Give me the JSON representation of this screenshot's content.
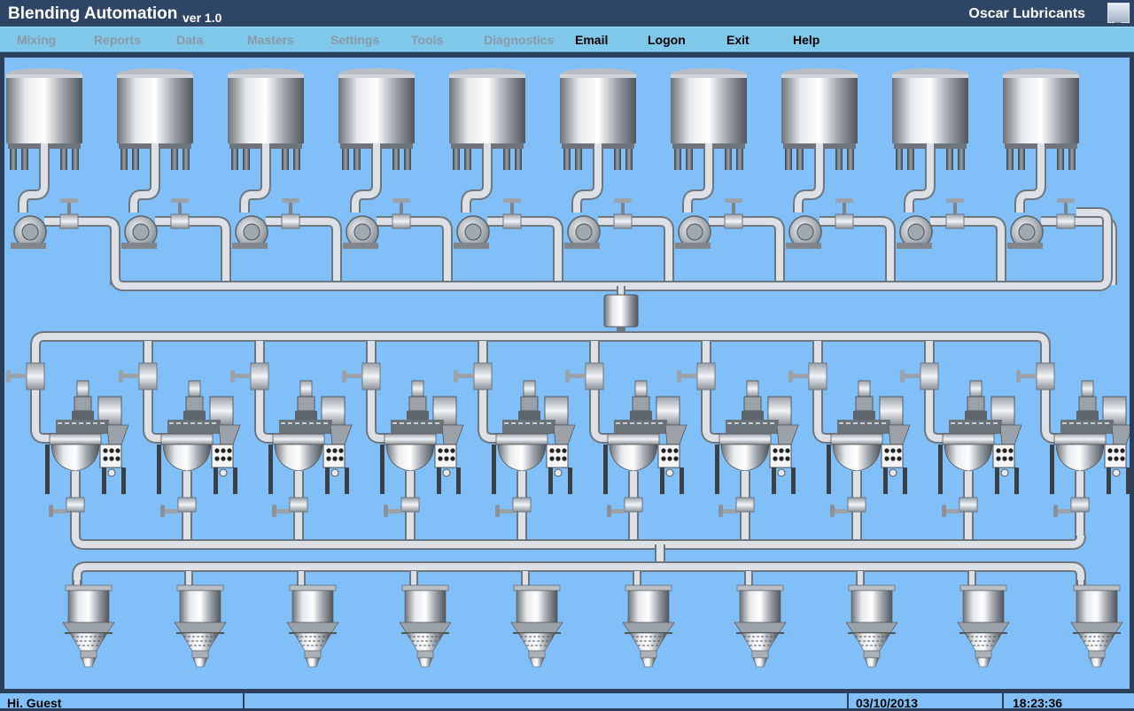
{
  "app": {
    "title": "Blending Automation",
    "version": "ver 1.0",
    "company": "Oscar Lubricants",
    "minimize_glyph": "_"
  },
  "menu": [
    {
      "label": "Mixing",
      "enabled": false
    },
    {
      "label": "Reports",
      "enabled": false
    },
    {
      "label": "Data",
      "enabled": false
    },
    {
      "label": "Masters",
      "enabled": false
    },
    {
      "label": "Settings",
      "enabled": false
    },
    {
      "label": "Tools",
      "enabled": false
    },
    {
      "label": "Diagnostics",
      "enabled": false
    },
    {
      "label": "Email",
      "enabled": true
    },
    {
      "label": "Logon",
      "enabled": true
    },
    {
      "label": "Exit",
      "enabled": true
    },
    {
      "label": "Help",
      "enabled": true
    }
  ],
  "plant": {
    "storage_tank_count": 10,
    "mixer_count": 10,
    "filling_hopper_count": 10
  },
  "status": {
    "greeting": "Hi. Guest",
    "message": "",
    "date": "03/10/2013",
    "time": "18:23:36"
  },
  "colors": {
    "canvas": "#80bff7",
    "menubar": "#80c8ea",
    "titlebar": "#2f4566",
    "pipe": "#c8ced4"
  }
}
